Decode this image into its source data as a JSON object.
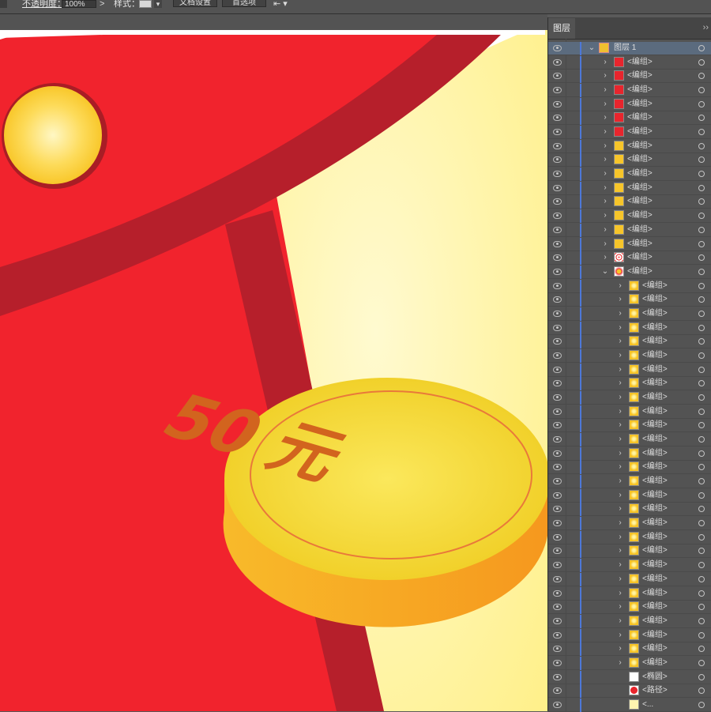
{
  "control_bar": {
    "opacity_label": "不透明度：",
    "opacity_value": "100%",
    "opacity_arrow": ">",
    "style_label": "样式：",
    "style_arrow": "▾",
    "doc_setup_label": "文档设置",
    "preferences_label": "首选项",
    "arrange_label": "⇤ ▾"
  },
  "canvas": {
    "coin": {
      "text": "50 元",
      "face_color": "#f3d232",
      "side_color": "#f7a51e",
      "text_color": "#d2641e"
    },
    "colors": {
      "envelope_red": "#f1232d",
      "envelope_dark": "#b61f2b",
      "pocket_cream": "#fff7a9",
      "button_gold": "#fbc934"
    }
  },
  "layers_panel": {
    "tab_label": "图层",
    "menu_icon": "››",
    "rows": [
      {
        "label": "图层  1",
        "level": 0,
        "chevron": "⌄",
        "thumb": "layer",
        "selected": true
      },
      {
        "label": "<编组>",
        "level": 1,
        "chevron": "›",
        "thumb": "red"
      },
      {
        "label": "<编组>",
        "level": 1,
        "chevron": "›",
        "thumb": "red"
      },
      {
        "label": "<编组>",
        "level": 1,
        "chevron": "›",
        "thumb": "red"
      },
      {
        "label": "<编组>",
        "level": 1,
        "chevron": "›",
        "thumb": "red"
      },
      {
        "label": "<编组>",
        "level": 1,
        "chevron": "›",
        "thumb": "red"
      },
      {
        "label": "<编组>",
        "level": 1,
        "chevron": "›",
        "thumb": "red"
      },
      {
        "label": "<编组>",
        "level": 1,
        "chevron": "›",
        "thumb": "gold"
      },
      {
        "label": "<编组>",
        "level": 1,
        "chevron": "›",
        "thumb": "gold"
      },
      {
        "label": "<编组>",
        "level": 1,
        "chevron": "›",
        "thumb": "gold"
      },
      {
        "label": "<编组>",
        "level": 1,
        "chevron": "›",
        "thumb": "gold"
      },
      {
        "label": "<编组>",
        "level": 1,
        "chevron": "›",
        "thumb": "gold"
      },
      {
        "label": "<编组>",
        "level": 1,
        "chevron": "›",
        "thumb": "gold"
      },
      {
        "label": "<编组>",
        "level": 1,
        "chevron": "›",
        "thumb": "gold"
      },
      {
        "label": "<编组>",
        "level": 1,
        "chevron": "›",
        "thumb": "gold"
      },
      {
        "label": "<编组>",
        "level": 1,
        "chevron": "›",
        "thumb": "dots"
      },
      {
        "label": "<编组>",
        "level": 1,
        "chevron": "⌄",
        "thumb": "badge"
      },
      {
        "label": "<编组>",
        "level": 2,
        "chevron": "›",
        "thumb": "coin"
      },
      {
        "label": "<编组>",
        "level": 2,
        "chevron": "›",
        "thumb": "coin"
      },
      {
        "label": "<编组>",
        "level": 2,
        "chevron": "›",
        "thumb": "coin"
      },
      {
        "label": "<编组>",
        "level": 2,
        "chevron": "›",
        "thumb": "coin"
      },
      {
        "label": "<编组>",
        "level": 2,
        "chevron": "›",
        "thumb": "coin"
      },
      {
        "label": "<编组>",
        "level": 2,
        "chevron": "›",
        "thumb": "coin"
      },
      {
        "label": "<编组>",
        "level": 2,
        "chevron": "›",
        "thumb": "coin"
      },
      {
        "label": "<编组>",
        "level": 2,
        "chevron": "›",
        "thumb": "coin"
      },
      {
        "label": "<编组>",
        "level": 2,
        "chevron": "›",
        "thumb": "coin"
      },
      {
        "label": "<编组>",
        "level": 2,
        "chevron": "›",
        "thumb": "coin"
      },
      {
        "label": "<编组>",
        "level": 2,
        "chevron": "›",
        "thumb": "coin"
      },
      {
        "label": "<编组>",
        "level": 2,
        "chevron": "›",
        "thumb": "coin"
      },
      {
        "label": "<编组>",
        "level": 2,
        "chevron": "›",
        "thumb": "coin"
      },
      {
        "label": "<编组>",
        "level": 2,
        "chevron": "›",
        "thumb": "coin"
      },
      {
        "label": "<编组>",
        "level": 2,
        "chevron": "›",
        "thumb": "coin"
      },
      {
        "label": "<编组>",
        "level": 2,
        "chevron": "›",
        "thumb": "coin"
      },
      {
        "label": "<编组>",
        "level": 2,
        "chevron": "›",
        "thumb": "coin"
      },
      {
        "label": "<编组>",
        "level": 2,
        "chevron": "›",
        "thumb": "coin"
      },
      {
        "label": "<编组>",
        "level": 2,
        "chevron": "›",
        "thumb": "coin"
      },
      {
        "label": "<编组>",
        "level": 2,
        "chevron": "›",
        "thumb": "coin"
      },
      {
        "label": "<编组>",
        "level": 2,
        "chevron": "›",
        "thumb": "coin"
      },
      {
        "label": "<编组>",
        "level": 2,
        "chevron": "›",
        "thumb": "coin"
      },
      {
        "label": "<编组>",
        "level": 2,
        "chevron": "›",
        "thumb": "coin"
      },
      {
        "label": "<编组>",
        "level": 2,
        "chevron": "›",
        "thumb": "coin"
      },
      {
        "label": "<编组>",
        "level": 2,
        "chevron": "›",
        "thumb": "coin"
      },
      {
        "label": "<编组>",
        "level": 2,
        "chevron": "›",
        "thumb": "coin"
      },
      {
        "label": "<编组>",
        "level": 2,
        "chevron": "›",
        "thumb": "coin"
      },
      {
        "label": "<编组>",
        "level": 2,
        "chevron": "›",
        "thumb": "coin"
      },
      {
        "label": "<椭圆>",
        "level": 2,
        "chevron": "",
        "thumb": "white"
      },
      {
        "label": "<路径>",
        "level": 2,
        "chevron": "",
        "thumb": "redcircle"
      },
      {
        "label": "<...",
        "level": 2,
        "chevron": "",
        "thumb": "cream"
      }
    ]
  }
}
